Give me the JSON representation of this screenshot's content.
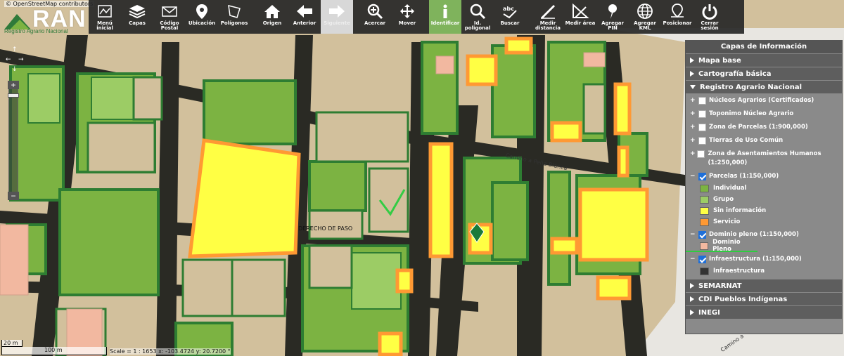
{
  "map": {
    "attribution": "© OpenStreetMap contributors",
    "logo_text": "RAN",
    "logo_subtitle": "Registro Agrario Nacional",
    "road_label_1": "DERECHO DE PASO",
    "road_label_2": "Camino a Peña Blanca",
    "road_label_3": "Camino a",
    "scale_small": "20 m",
    "scale_large": "100 m",
    "scale_text": "Scale = 1 : 1653   x: -103.4724   y: 20.7200 °"
  },
  "toolbar": [
    {
      "key": "menu",
      "label": "Menú inicial",
      "icon": "map-icon"
    },
    {
      "key": "capas",
      "label": "Capas",
      "icon": "layers-icon"
    },
    {
      "key": "postal",
      "label": "Código Postal",
      "icon": "envelope-icon"
    },
    {
      "key": "ubicacion",
      "label": "Ubicación",
      "icon": "location-pin-icon"
    },
    {
      "key": "poligonos",
      "label": "Polígonos",
      "icon": "polygon-icon"
    },
    {
      "key": "origen",
      "label": "Origen",
      "icon": "home-icon"
    },
    {
      "key": "anterior",
      "label": "Anterior",
      "icon": "arrow-left-icon"
    },
    {
      "key": "siguiente",
      "label": "Siguiente",
      "icon": "arrow-right-icon"
    },
    {
      "key": "acercar",
      "label": "Acercar",
      "icon": "zoom-in-icon"
    },
    {
      "key": "mover",
      "label": "Mover",
      "icon": "move-icon"
    },
    {
      "key": "identificar",
      "label": "Identificar",
      "icon": "info-icon"
    },
    {
      "key": "idpoligonal",
      "label": "Id. poligonal",
      "icon": "search-polygon-icon"
    },
    {
      "key": "buscar",
      "label": "Buscar",
      "icon": "search-text-icon"
    },
    {
      "key": "medirdist",
      "label": "Medir distancia",
      "icon": "ruler-icon"
    },
    {
      "key": "medirarea",
      "label": "Medir área",
      "icon": "area-ruler-icon"
    },
    {
      "key": "pin",
      "label": "Agregar PIN",
      "icon": "pushpin-icon"
    },
    {
      "key": "kml",
      "label": "Agregar KML",
      "icon": "globe-icon"
    },
    {
      "key": "posicionar",
      "label": "Posicionar",
      "icon": "target-pin-icon"
    },
    {
      "key": "cerrar",
      "label": "Cerrar sesión",
      "icon": "power-icon"
    }
  ],
  "panel": {
    "title": "Capas de Información",
    "mapa_base": "Mapa base",
    "cartografia": "Cartografía básica",
    "ran": "Registro Agrario Nacional",
    "nucleos": "Núcleos Agrarios (Certificados)",
    "toponimo": "Toponimo Núcleo Agrario",
    "zona_parcelas": "Zona de Parcelas (1:900,000)",
    "tierras": "Tierras de Uso Común",
    "zona_asent": "Zona de Asentamientos Humanos (1:250,000)",
    "parcelas": "Parcelas (1:150,000)",
    "legend_individual": "Individual",
    "legend_grupo": "Grupo",
    "legend_sininfo": "Sin información",
    "legend_servicio": "Servicio",
    "dominio": "Dominio pleno (1:150,000)",
    "legend_dominio": "Dominio Pleno",
    "infra": "Infraestructura (1:150,000)",
    "legend_infra": "Infraestructura",
    "semarnat": "SEMARNAT",
    "cdi": "CDI Pueblos Indígenas",
    "inegi": "INEGI"
  },
  "colors": {
    "individual": "#7cb342",
    "grupo": "#9ccc65",
    "sin_info": "#ffff44",
    "servicio": "#ff9933",
    "dominio": "#f2b8a0",
    "infra": "#333333"
  }
}
